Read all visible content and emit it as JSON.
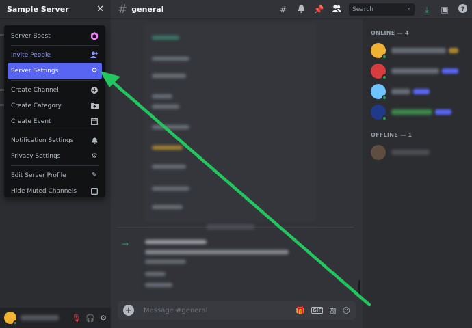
{
  "server": {
    "name": "Sample Server",
    "close_icon": "close-icon"
  },
  "menu": {
    "items": [
      {
        "label": "Server Boost",
        "icon": "boost-icon"
      },
      {
        "label": "Invite People",
        "icon": "add-person-icon"
      },
      {
        "label": "Server Settings",
        "icon": "gear-icon"
      },
      {
        "label": "Create Channel",
        "icon": "plus-circle-icon"
      },
      {
        "label": "Create Category",
        "icon": "folder-plus-icon"
      },
      {
        "label": "Create Event",
        "icon": "calendar-plus-icon"
      },
      {
        "label": "Notification Settings",
        "icon": "bell-icon"
      },
      {
        "label": "Privacy Settings",
        "icon": "shield-icon"
      },
      {
        "label": "Edit Server Profile",
        "icon": "pencil-icon"
      },
      {
        "label": "Hide Muted Channels",
        "icon": "checkbox-icon"
      }
    ]
  },
  "topbar": {
    "channel": "general",
    "search_placeholder": "Search"
  },
  "input": {
    "placeholder": "Message #general"
  },
  "members": {
    "online_heading": "ONLINE — 4",
    "offline_heading": "OFFLINE — 1"
  },
  "colors": {
    "accent": "#5865f2",
    "online": "#23a55a",
    "arrow": "#22c55e",
    "boost": "#f47fff"
  }
}
